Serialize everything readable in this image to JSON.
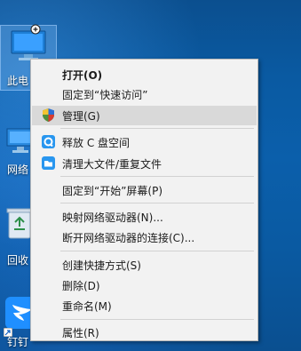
{
  "desktop": {
    "icons": [
      {
        "label": "此电"
      },
      {
        "label": "网络"
      },
      {
        "label": "回收"
      },
      {
        "label": "钉钉"
      }
    ]
  },
  "menu": {
    "items": [
      {
        "label": "打开(O)"
      },
      {
        "label": "固定到“快速访问”"
      },
      {
        "label": "管理(G)",
        "icon": "uac-shield-icon"
      },
      {
        "label": "释放 C 盘空间",
        "icon": "cleanup-icon"
      },
      {
        "label": "清理大文件/重复文件",
        "icon": "folder-clean-icon"
      },
      {
        "label": "固定到“开始”屏幕(P)"
      },
      {
        "label": "映射网络驱动器(N)..."
      },
      {
        "label": "断开网络驱动器的连接(C)..."
      },
      {
        "label": "创建快捷方式(S)"
      },
      {
        "label": "删除(D)"
      },
      {
        "label": "重命名(M)"
      },
      {
        "label": "属性(R)"
      }
    ]
  },
  "colors": {
    "menu_bg": "#f2f2f2",
    "highlight": "#d9d9d9",
    "desktop": "#0b5fab"
  }
}
